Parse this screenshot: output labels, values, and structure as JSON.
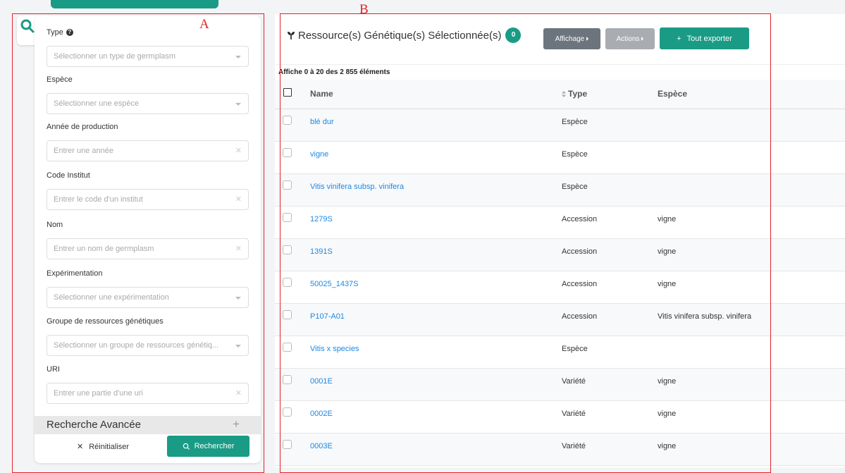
{
  "filters": [
    {
      "label": "Type",
      "placeholder": "Sélectionner un type de germplasm",
      "kind": "select",
      "help": true
    },
    {
      "label": "Espèce",
      "placeholder": "Sélectionner une espèce",
      "kind": "select"
    },
    {
      "label": "Année de production",
      "placeholder": "Entrer une année",
      "kind": "text"
    },
    {
      "label": "Code Institut",
      "placeholder": "Entrer le code d'un institut",
      "kind": "text"
    },
    {
      "label": "Nom",
      "placeholder": "Entrer un nom de germplasm",
      "kind": "text"
    },
    {
      "label": "Expérimentation",
      "placeholder": "Sélectionner une expérimentation",
      "kind": "select"
    },
    {
      "label": "Groupe de ressources génétiques",
      "placeholder": "Sélectionner un groupe de ressources génétiq...",
      "kind": "select"
    },
    {
      "label": "URI",
      "placeholder": "Entrer une partie d'une uri",
      "kind": "text"
    }
  ],
  "advanced_label": "Recherche Avancée",
  "reset_label": "Réinitialiser",
  "search_label": "Rechercher",
  "results": {
    "title": "Ressource(s) Génétique(s) Sélectionnée(s)",
    "selected_count": "0",
    "display_label": "Affichage",
    "actions_label": "Actions",
    "export_label": "Tout exporter",
    "count_text": "Affiche 0 à 20 des 2 855 éléments"
  },
  "columns": {
    "name": "Name",
    "type": "Type",
    "espece": "Espèce"
  },
  "rows": [
    {
      "name": "blé dur",
      "type": "Espèce",
      "espece": ""
    },
    {
      "name": "vigne",
      "type": "Espèce",
      "espece": ""
    },
    {
      "name": "Vitis vinifera subsp. vinifera",
      "type": "Espèce",
      "espece": ""
    },
    {
      "name": "1279S",
      "type": "Accession",
      "espece": "vigne"
    },
    {
      "name": "1391S",
      "type": "Accession",
      "espece": "vigne"
    },
    {
      "name": "50025_1437S",
      "type": "Accession",
      "espece": "vigne"
    },
    {
      "name": "P107-A01",
      "type": "Accession",
      "espece": "Vitis vinifera subsp. vinifera"
    },
    {
      "name": "Vitis x species",
      "type": "Espèce",
      "espece": ""
    },
    {
      "name": "0001E",
      "type": "Variété",
      "espece": "vigne"
    },
    {
      "name": "0002E",
      "type": "Variété",
      "espece": "vigne"
    },
    {
      "name": "0003E",
      "type": "Variété",
      "espece": "vigne"
    }
  ],
  "annotations": {
    "a": "A",
    "b": "B"
  },
  "colors": {
    "accent": "#1a9b85",
    "link": "#1e88e5",
    "annotation": "#e2232b"
  }
}
